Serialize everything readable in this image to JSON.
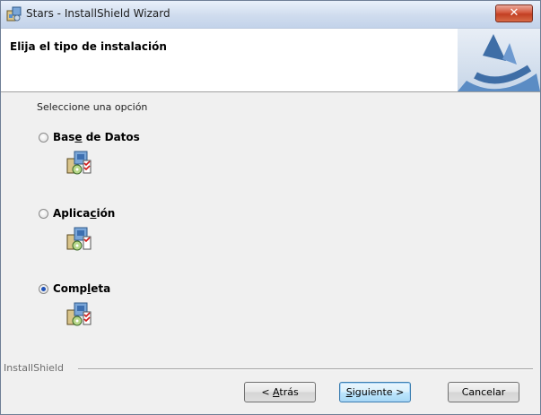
{
  "window": {
    "title": "Stars - InstallShield Wizard",
    "close_label": "✕"
  },
  "banner": {
    "title": "Elija el tipo de instalación"
  },
  "content": {
    "prompt": "Seleccione una opción",
    "options": [
      {
        "pre": "Bas",
        "mnemonic": "e",
        "post": " de Datos",
        "selected": false,
        "icon": "install-package-icon"
      },
      {
        "pre": "Aplica",
        "mnemonic": "c",
        "post": "ión",
        "selected": false,
        "icon": "install-package-icon"
      },
      {
        "pre": "Comp",
        "mnemonic": "l",
        "post": "eta",
        "selected": true,
        "icon": "install-package-icon"
      }
    ]
  },
  "footer": {
    "brand": "InstallShield",
    "back": {
      "pre": "< ",
      "mnemonic": "A",
      "post": "trás"
    },
    "next": {
      "pre": "",
      "mnemonic": "S",
      "post": "iguiente >"
    },
    "cancel": "Cancelar"
  },
  "colors": {
    "accent": "#1f52b8",
    "close": "#c23f22",
    "banner_art": "#4a7fb8"
  }
}
